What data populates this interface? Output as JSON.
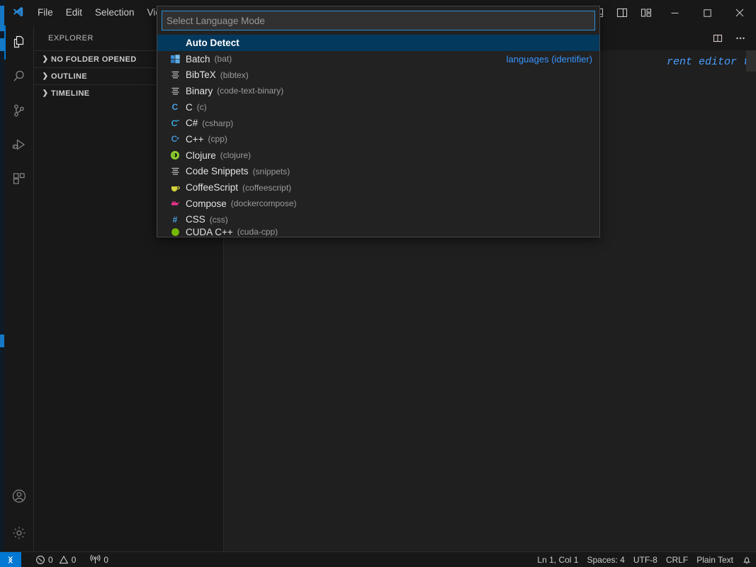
{
  "window": {
    "app_name": "Visual Studio Code",
    "logo_icon": "vscode-logo-icon",
    "menu": [
      {
        "label": "File",
        "name": "menu-file"
      },
      {
        "label": "Edit",
        "name": "menu-edit"
      },
      {
        "label": "Selection",
        "name": "menu-selection"
      },
      {
        "label": "View",
        "name": "menu-view"
      }
    ],
    "layout_buttons": [
      {
        "name": "toggle-panel-icon",
        "title": "Toggle Panel"
      },
      {
        "name": "toggle-secondary-sidebar-icon",
        "title": "Toggle Secondary Side Bar"
      },
      {
        "name": "customize-layout-icon",
        "title": "Customize Layout"
      }
    ],
    "window_controls": [
      {
        "name": "minimize-button",
        "glyph": "minimize"
      },
      {
        "name": "maximize-button",
        "glyph": "maximize"
      },
      {
        "name": "close-button",
        "glyph": "close"
      }
    ]
  },
  "activity_bar": {
    "items": [
      {
        "name": "activity-explorer",
        "icon": "files-icon",
        "label": "Explorer",
        "active": true
      },
      {
        "name": "activity-search",
        "icon": "search-icon",
        "label": "Search",
        "active": false
      },
      {
        "name": "activity-source-control",
        "icon": "source-control-icon",
        "label": "Source Control",
        "active": false
      },
      {
        "name": "activity-run-debug",
        "icon": "run-and-debug-icon",
        "label": "Run and Debug",
        "active": false
      },
      {
        "name": "activity-extensions",
        "icon": "extensions-icon",
        "label": "Extensions",
        "active": false
      }
    ],
    "bottom_items": [
      {
        "name": "activity-accounts",
        "icon": "account-icon",
        "label": "Accounts"
      },
      {
        "name": "activity-manage",
        "icon": "gear-icon",
        "label": "Manage"
      }
    ]
  },
  "sidebar": {
    "title": "EXPLORER",
    "sections": [
      {
        "label": "NO FOLDER OPENED",
        "expanded": false,
        "icon": "chevron-right-icon"
      },
      {
        "label": "OUTLINE",
        "expanded": false,
        "icon": "chevron-right-icon"
      },
      {
        "label": "TIMELINE",
        "expanded": false,
        "icon": "chevron-right-icon"
      }
    ]
  },
  "editor": {
    "title_actions": [
      {
        "name": "split-editor-right-button",
        "icon": "split-editor-icon"
      },
      {
        "name": "editor-more-actions-button",
        "icon": "ellipsis-icon"
      }
    ],
    "watermark_text": "rent editor to"
  },
  "quick_pick": {
    "name": "select-language-mode-quickpick",
    "placeholder": "Select Language Mode",
    "value": "",
    "right_label": "languages (identifier)",
    "selected_index": 0,
    "items": [
      {
        "label": "Auto Detect",
        "identifier": "",
        "icon": "none",
        "selected": true
      },
      {
        "label": "Batch",
        "identifier": "(bat)",
        "icon": "windows-icon",
        "selected": false
      },
      {
        "label": "BibTeX",
        "identifier": "(bibtex)",
        "icon": "lines-icon",
        "selected": false
      },
      {
        "label": "Binary",
        "identifier": "(code-text-binary)",
        "icon": "lines-icon",
        "selected": false
      },
      {
        "label": "C",
        "identifier": "(c)",
        "icon": "c-icon",
        "selected": false
      },
      {
        "label": "C#",
        "identifier": "(csharp)",
        "icon": "csharp-icon",
        "selected": false
      },
      {
        "label": "C++",
        "identifier": "(cpp)",
        "icon": "cpp-icon",
        "selected": false
      },
      {
        "label": "Clojure",
        "identifier": "(clojure)",
        "icon": "clojure-icon",
        "selected": false
      },
      {
        "label": "Code Snippets",
        "identifier": "(snippets)",
        "icon": "lines-icon",
        "selected": false
      },
      {
        "label": "CoffeeScript",
        "identifier": "(coffeescript)",
        "icon": "coffee-icon",
        "selected": false
      },
      {
        "label": "Compose",
        "identifier": "(dockercompose)",
        "icon": "docker-icon",
        "selected": false
      },
      {
        "label": "CSS",
        "identifier": "(css)",
        "icon": "hash-icon",
        "selected": false
      },
      {
        "label": "CUDA C++",
        "identifier": "(cuda-cpp)",
        "icon": "cuda-icon",
        "selected": false
      }
    ]
  },
  "status_bar": {
    "remote_label": "",
    "remote_icon": "remote-window-icon",
    "problems": {
      "errors": "0",
      "warnings": "0",
      "error_icon": "error-circle-icon",
      "warning_icon": "warning-triangle-icon"
    },
    "ports": {
      "count": "0",
      "icon": "radio-tower-icon"
    },
    "right_items": [
      {
        "name": "status-cursor-position",
        "label": "Ln 1, Col 1"
      },
      {
        "name": "status-indentation",
        "label": "Spaces: 4"
      },
      {
        "name": "status-encoding",
        "label": "UTF-8"
      },
      {
        "name": "status-eol",
        "label": "CRLF"
      },
      {
        "name": "status-language-mode",
        "label": "Plain Text"
      }
    ],
    "bell_icon": "bell-icon"
  },
  "colors": {
    "accent": "#0078d4",
    "selection": "#04395e",
    "titlebar_bg": "#181818",
    "editor_bg": "#1f1f1f",
    "quickpick_bg": "#222222",
    "focus_border": "#2a8fd8"
  }
}
